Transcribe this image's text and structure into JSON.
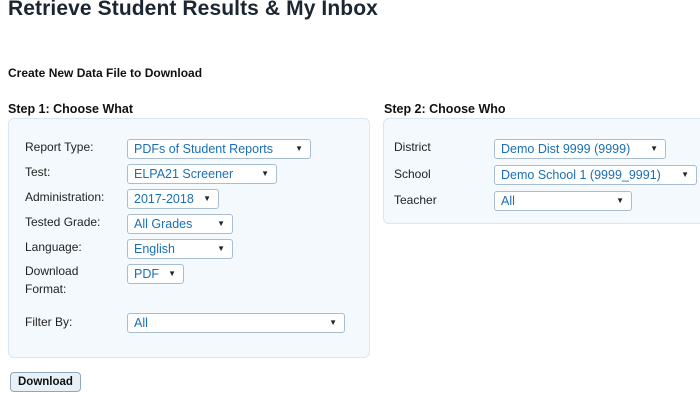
{
  "page": {
    "title": "Retrieve Student Results & My Inbox",
    "section_title": "Create New Data File to Download"
  },
  "step1": {
    "heading": "Step 1: Choose What",
    "fields": {
      "report_type": {
        "label": "Report Type:",
        "value": "PDFs of Student Reports"
      },
      "test": {
        "label": "Test:",
        "value": "ELPA21 Screener"
      },
      "administration": {
        "label": "Administration:",
        "value": "2017-2018"
      },
      "tested_grade": {
        "label": "Tested Grade:",
        "value": "All Grades"
      },
      "language": {
        "label": "Language:",
        "value": "English"
      },
      "download_format": {
        "label_line1": "Download",
        "label_line2": "Format:",
        "value": "PDF"
      },
      "filter_by": {
        "label": "Filter By:",
        "value": "All"
      }
    }
  },
  "step2": {
    "heading": "Step 2: Choose Who",
    "fields": {
      "district": {
        "label": "District",
        "value": "Demo Dist 9999 (9999)"
      },
      "school": {
        "label": "School",
        "value": "Demo School 1 (9999_9991)"
      },
      "teacher": {
        "label": "Teacher",
        "value": "All"
      }
    }
  },
  "actions": {
    "download_label": "Download"
  },
  "icons": {
    "dropdown_caret": "▼"
  },
  "colors": {
    "panel_background": "#f3f9fd",
    "select_text": "#1b6fb5",
    "title_text": "#1b2630"
  }
}
